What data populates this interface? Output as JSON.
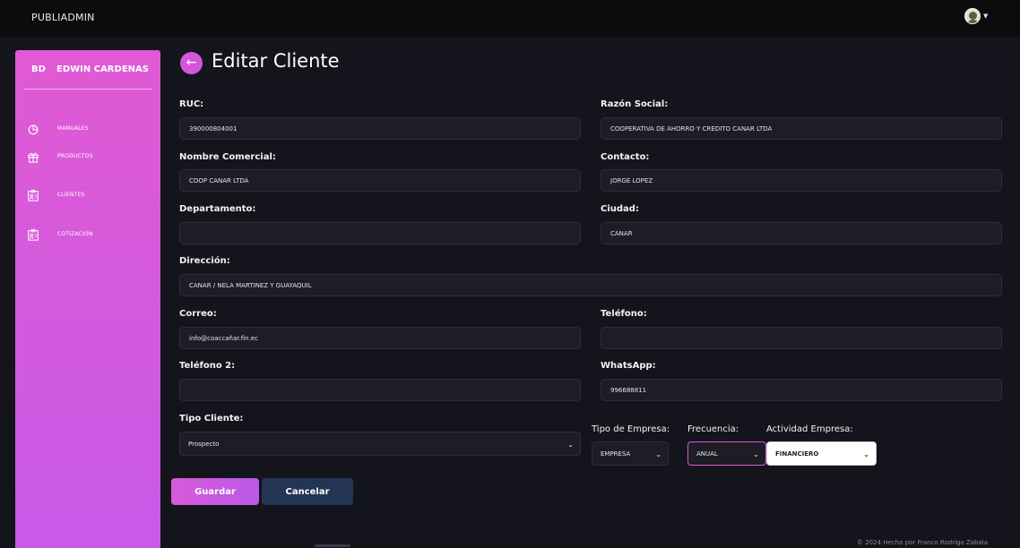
{
  "app": {
    "brand": "PUBLIADMIN"
  },
  "user": {
    "initials": "BD",
    "name": "EDWIN CARDENAS"
  },
  "sidebar": {
    "items": [
      {
        "label": "MANUALES",
        "icon": "pie-chart-icon"
      },
      {
        "label": "PRODUCTOS",
        "icon": "gift-icon"
      },
      {
        "label": "CLIENTES",
        "icon": "id-card-icon"
      },
      {
        "label": "COTIZACIÓN",
        "icon": "id-card-icon"
      }
    ]
  },
  "page": {
    "title": "Editar Cliente",
    "back_icon": "arrow-left-icon"
  },
  "form": {
    "ruc": {
      "label": "RUC:",
      "value": "390000804001"
    },
    "razon_social": {
      "label": "Razón Social:",
      "value": "COOPERATIVA DE AHORRO Y CREDITO CAÑAR LTDA"
    },
    "nombre_comercial": {
      "label": "Nombre Comercial:",
      "value": "COOP CAÑAR LTDA"
    },
    "contacto": {
      "label": "Contacto:",
      "value": "JORGE LOPEZ"
    },
    "departamento": {
      "label": "Departamento:",
      "value": ""
    },
    "ciudad": {
      "label": "Ciudad:",
      "value": "CAÑAR"
    },
    "direccion": {
      "label": "Dirección:",
      "value": "CAÑAR / NELA MARTINEZ Y GUAYAQUIL"
    },
    "correo": {
      "label": "Correo:",
      "value": "info@coaccañar.fin.ec"
    },
    "telefono": {
      "label": "Teléfono:",
      "value": ""
    },
    "telefono2": {
      "label": "Teléfono 2:",
      "value": ""
    },
    "whatsapp": {
      "label": "WhatsApp:",
      "value": "996688811"
    },
    "tipo_cliente": {
      "label": "Tipo Cliente:",
      "value": "Prospecto"
    },
    "tipo_empresa": {
      "label": "Tipo de Empresa:",
      "value": "EMPRESA"
    },
    "frecuencia": {
      "label": "Frecuencia:",
      "value": "ANUAL"
    },
    "actividad_empresa": {
      "label": "Actividad Empresa:",
      "value": "FINANCIERO"
    }
  },
  "buttons": {
    "save": "Guardar",
    "cancel": "Cancelar"
  },
  "footer": {
    "text": "© 2024 Hecho por Franco Rodrigo Zabala"
  },
  "colors": {
    "accent": "#d655dc",
    "sidebar_top": "#e05ad3",
    "sidebar_bottom": "#c85ae8",
    "cancel": "#243553",
    "background": "#14141c"
  }
}
